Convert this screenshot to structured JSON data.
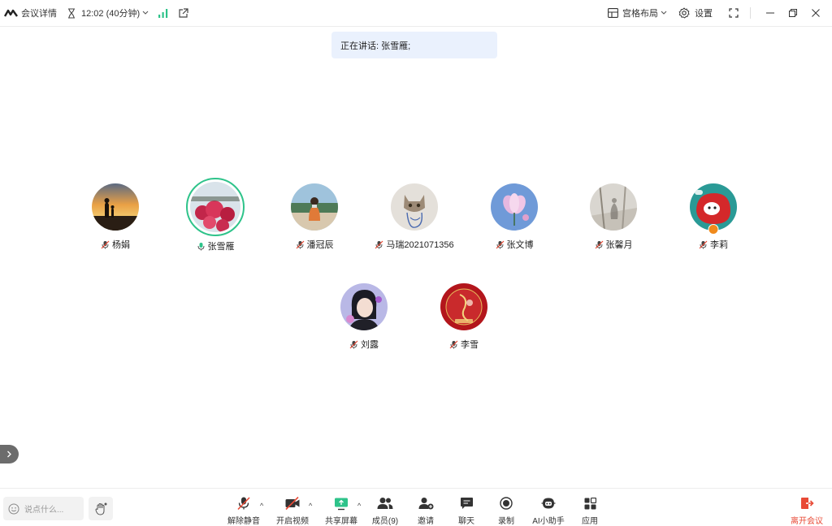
{
  "topbar": {
    "meeting_details": "会议详情",
    "timer": "12:02 (40分钟)",
    "layout_label": "宫格布局",
    "settings_label": "设置"
  },
  "speaking": {
    "text": "正在讲话: 张雪雁;"
  },
  "participants": [
    {
      "name": "杨娟",
      "muted": true
    },
    {
      "name": "张雪雁",
      "muted": false
    },
    {
      "name": "潘冠辰",
      "muted": true
    },
    {
      "name": "马瑞2021071356",
      "muted": true
    },
    {
      "name": "张文博",
      "muted": true
    },
    {
      "name": "张馨月",
      "muted": true
    },
    {
      "name": "李莉",
      "muted": true,
      "host": true
    },
    {
      "name": "刘露",
      "muted": true
    },
    {
      "name": "李雪",
      "muted": true
    }
  ],
  "bottombar": {
    "chat_placeholder": "说点什么...",
    "unmute": "解除静音",
    "start_video": "开启视频",
    "share_screen": "共享屏幕",
    "members": "成员(9)",
    "invite": "邀请",
    "chat": "聊天",
    "record": "录制",
    "ai_assistant": "AI小助手",
    "apps": "应用",
    "leave": "离开会议"
  },
  "colors": {
    "active_ring": "#2ec38a",
    "leave": "#e84a36",
    "signal": "#2ec38a"
  }
}
